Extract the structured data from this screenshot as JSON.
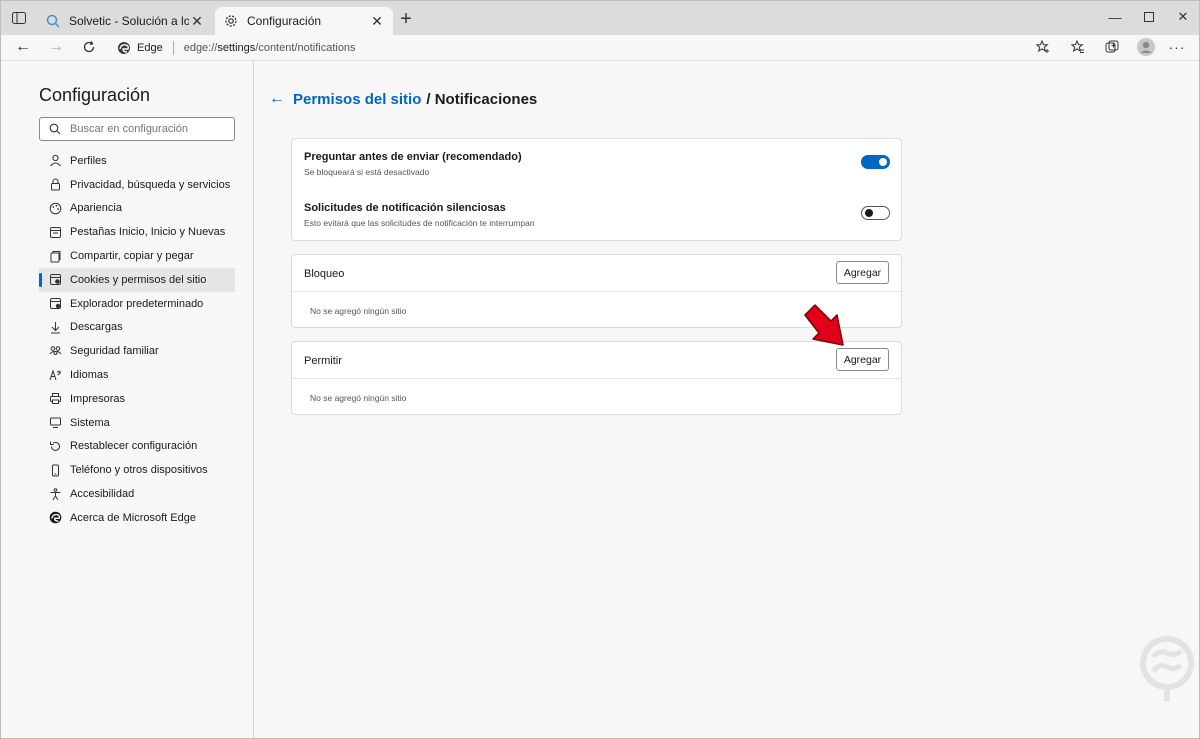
{
  "tabs": [
    {
      "title": "Solvetic - Solución a los problem",
      "favicon": "search-icon",
      "active": false
    },
    {
      "title": "Configuración",
      "favicon": "gear-icon",
      "active": true
    }
  ],
  "address": {
    "brand": "Edge",
    "url_prefix": "edge://",
    "url_bold": "settings",
    "url_rest": "/content/notifications"
  },
  "sidebar": {
    "title": "Configuración",
    "search_placeholder": "Buscar en configuración",
    "items": [
      {
        "label": "Perfiles",
        "icon": "profile-icon"
      },
      {
        "label": "Privacidad, búsqueda y servicios",
        "icon": "lock-icon"
      },
      {
        "label": "Apariencia",
        "icon": "appearance-icon"
      },
      {
        "label": "Pestañas Inicio, Inicio y Nuevas",
        "icon": "tabs-icon"
      },
      {
        "label": "Compartir, copiar y pegar",
        "icon": "share-icon"
      },
      {
        "label": "Cookies y permisos del sitio",
        "icon": "cookies-icon",
        "selected": true
      },
      {
        "label": "Explorador predeterminado",
        "icon": "browser-icon"
      },
      {
        "label": "Descargas",
        "icon": "download-icon"
      },
      {
        "label": "Seguridad familiar",
        "icon": "family-icon"
      },
      {
        "label": "Idiomas",
        "icon": "language-icon"
      },
      {
        "label": "Impresoras",
        "icon": "printer-icon"
      },
      {
        "label": "Sistema",
        "icon": "system-icon"
      },
      {
        "label": "Restablecer configuración",
        "icon": "reset-icon"
      },
      {
        "label": "Teléfono y otros dispositivos",
        "icon": "phone-icon"
      },
      {
        "label": "Accesibilidad",
        "icon": "accessibility-icon"
      },
      {
        "label": "Acerca de Microsoft Edge",
        "icon": "edge-icon"
      }
    ]
  },
  "breadcrumb": {
    "link": "Permisos del sitio",
    "current": "/ Notificaciones"
  },
  "toggles": [
    {
      "title": "Preguntar antes de enviar (recomendado)",
      "subtitle": "Se bloqueará si está desactivado",
      "on": true
    },
    {
      "title": "Solicitudes de notificación silenciosas",
      "subtitle": "Esto evitará que las solicitudes de notificación te interrumpan",
      "on": false
    }
  ],
  "block": {
    "label": "Bloqueo",
    "button": "Agregar",
    "empty": "No se agregó ningún sitio"
  },
  "allow": {
    "label": "Permitir",
    "button": "Agregar",
    "empty": "No se agregó ningún sitio"
  },
  "colors": {
    "accent": "#0067c0",
    "arrow": "#e0001b"
  }
}
